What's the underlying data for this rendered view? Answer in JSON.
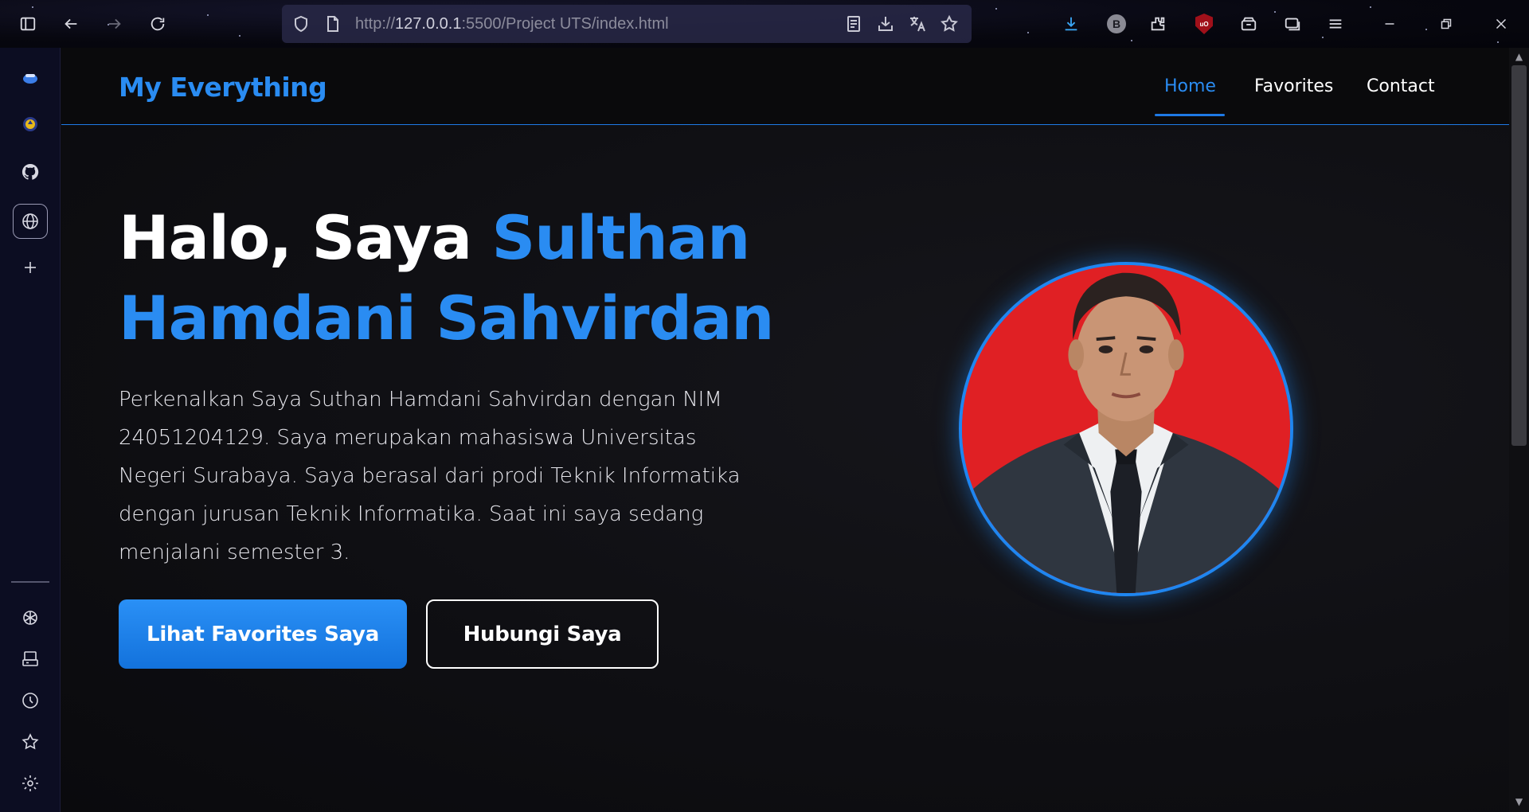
{
  "browser": {
    "url_prefix": "http://",
    "url_host": "127.0.0.1",
    "url_path": ":5500/Project UTS/index.html",
    "profile_initial": "B",
    "ublock_label": "uO"
  },
  "sidebar": {
    "items_top": [
      "extension-icon",
      "campus-icon",
      "github-icon",
      "globe-icon",
      "plus-icon"
    ],
    "items_bottom": [
      "chatgpt-icon",
      "drive-icon",
      "history-icon",
      "bookmark-star-icon",
      "settings-icon"
    ]
  },
  "nav": {
    "brand": "My Everything",
    "links": [
      {
        "label": "Home",
        "active": true
      },
      {
        "label": "Favorites",
        "active": false
      },
      {
        "label": "Contact",
        "active": false
      }
    ]
  },
  "hero": {
    "greeting": "Halo, Saya ",
    "name": "Sulthan Hamdani Sahvirdan",
    "description": "Perkenalkan Saya Suthan Hamdani Sahvirdan dengan NIM 24051204129. Saya merupakan mahasiswa Universitas Negeri Surabaya. Saya berasal dari prodi Teknik Informatika dengan jurusan Teknik Informatika. Saat ini saya sedang menjalani semester 3.",
    "primary_button": "Lihat Favorites Saya",
    "secondary_button": "Hubungi Saya"
  },
  "colors": {
    "accent": "#2a8cf2",
    "photo_background": "#e02024",
    "page_background": "#0f0f13"
  }
}
